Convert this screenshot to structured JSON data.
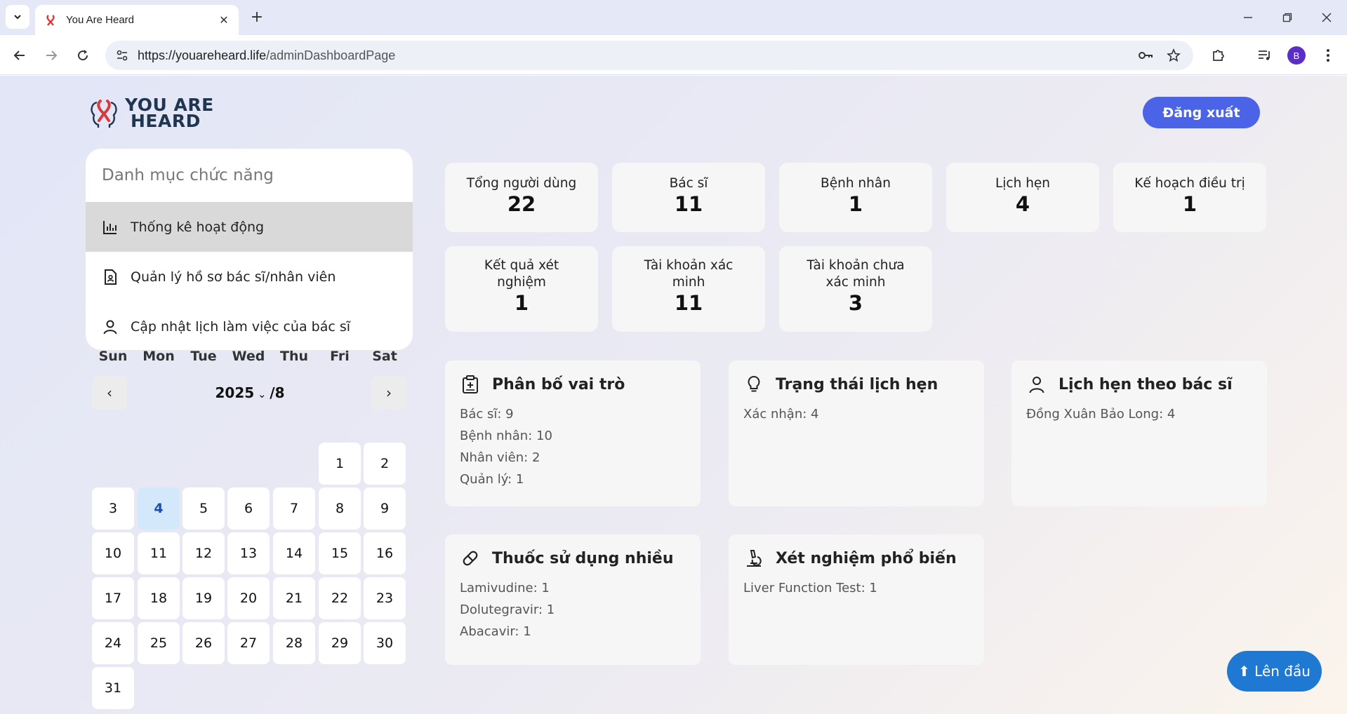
{
  "browser": {
    "tab_title": "You Are Heard",
    "url_host": "https://youareheard.life",
    "url_path": "/adminDashboardPage",
    "profile_initial": "B"
  },
  "header": {
    "logo_line1": "YOU ARE",
    "logo_line2": "HEARD",
    "logout_label": "Đăng xuất"
  },
  "menu": {
    "title": "Danh mục chức năng",
    "items": [
      {
        "label": "Thống kê hoạt động",
        "icon": "bar-chart-icon",
        "active": true
      },
      {
        "label": "Quản lý hồ sơ bác sĩ/nhân viên",
        "icon": "document-user-icon",
        "active": false
      },
      {
        "label": "Cập nhật lịch làm việc của bác sĩ",
        "icon": "user-icon",
        "active": false
      }
    ]
  },
  "calendar": {
    "prev": "‹",
    "next": "›",
    "year": "2025",
    "month": "/8",
    "weekdays": [
      "Sun",
      "Mon",
      "Tue",
      "Wed",
      "Thu",
      "Fri",
      "Sat"
    ],
    "days": [
      "1",
      "2",
      "3",
      "4",
      "5",
      "6",
      "7",
      "8",
      "9",
      "10",
      "11",
      "12",
      "13",
      "14",
      "15",
      "16",
      "17",
      "18",
      "19",
      "20",
      "21",
      "22",
      "23",
      "24",
      "25",
      "26",
      "27",
      "28",
      "29",
      "30",
      "31"
    ],
    "today": "4"
  },
  "stats": [
    {
      "label": "Tổng người dùng",
      "value": "22"
    },
    {
      "label": "Bác sĩ",
      "value": "11"
    },
    {
      "label": "Bệnh nhân",
      "value": "1"
    },
    {
      "label": "Lịch hẹn",
      "value": "4"
    },
    {
      "label": "Kế hoạch điều trị",
      "value": "1"
    },
    {
      "label": "Kết quả xét nghiệm",
      "value": "1"
    },
    {
      "label": "Tài khoản xác minh",
      "value": "11"
    },
    {
      "label": "Tài khoản chưa xác minh",
      "value": "3"
    }
  ],
  "cards": [
    {
      "title": "Phân bố vai trò",
      "icon": "clipboard-medical-icon",
      "lines": [
        "Bác sĩ: 9",
        "Bệnh nhân: 10",
        "Nhân viên: 2",
        "Quản lý: 1"
      ]
    },
    {
      "title": "Trạng thái lịch hẹn",
      "icon": "lightbulb-icon",
      "lines": [
        "Xác nhận: 4"
      ]
    },
    {
      "title": "Lịch hẹn theo bác sĩ",
      "icon": "user-icon",
      "lines": [
        "Đồng Xuân Bảo Long: 4"
      ]
    },
    {
      "title": "Thuốc sử dụng nhiều",
      "icon": "pill-icon",
      "lines": [
        "Lamivudine: 1",
        "Dolutegravir: 1",
        "Abacavir: 1"
      ]
    },
    {
      "title": "Xét nghiệm phổ biến",
      "icon": "microscope-icon",
      "lines": [
        "Liver Function Test: 1"
      ]
    }
  ],
  "back_to_top_label": "⬆ Lên đầu",
  "colors": {
    "accent": "#4a63e7",
    "back_to_top": "#1f78d1",
    "today_bg": "#d3e8fb"
  }
}
